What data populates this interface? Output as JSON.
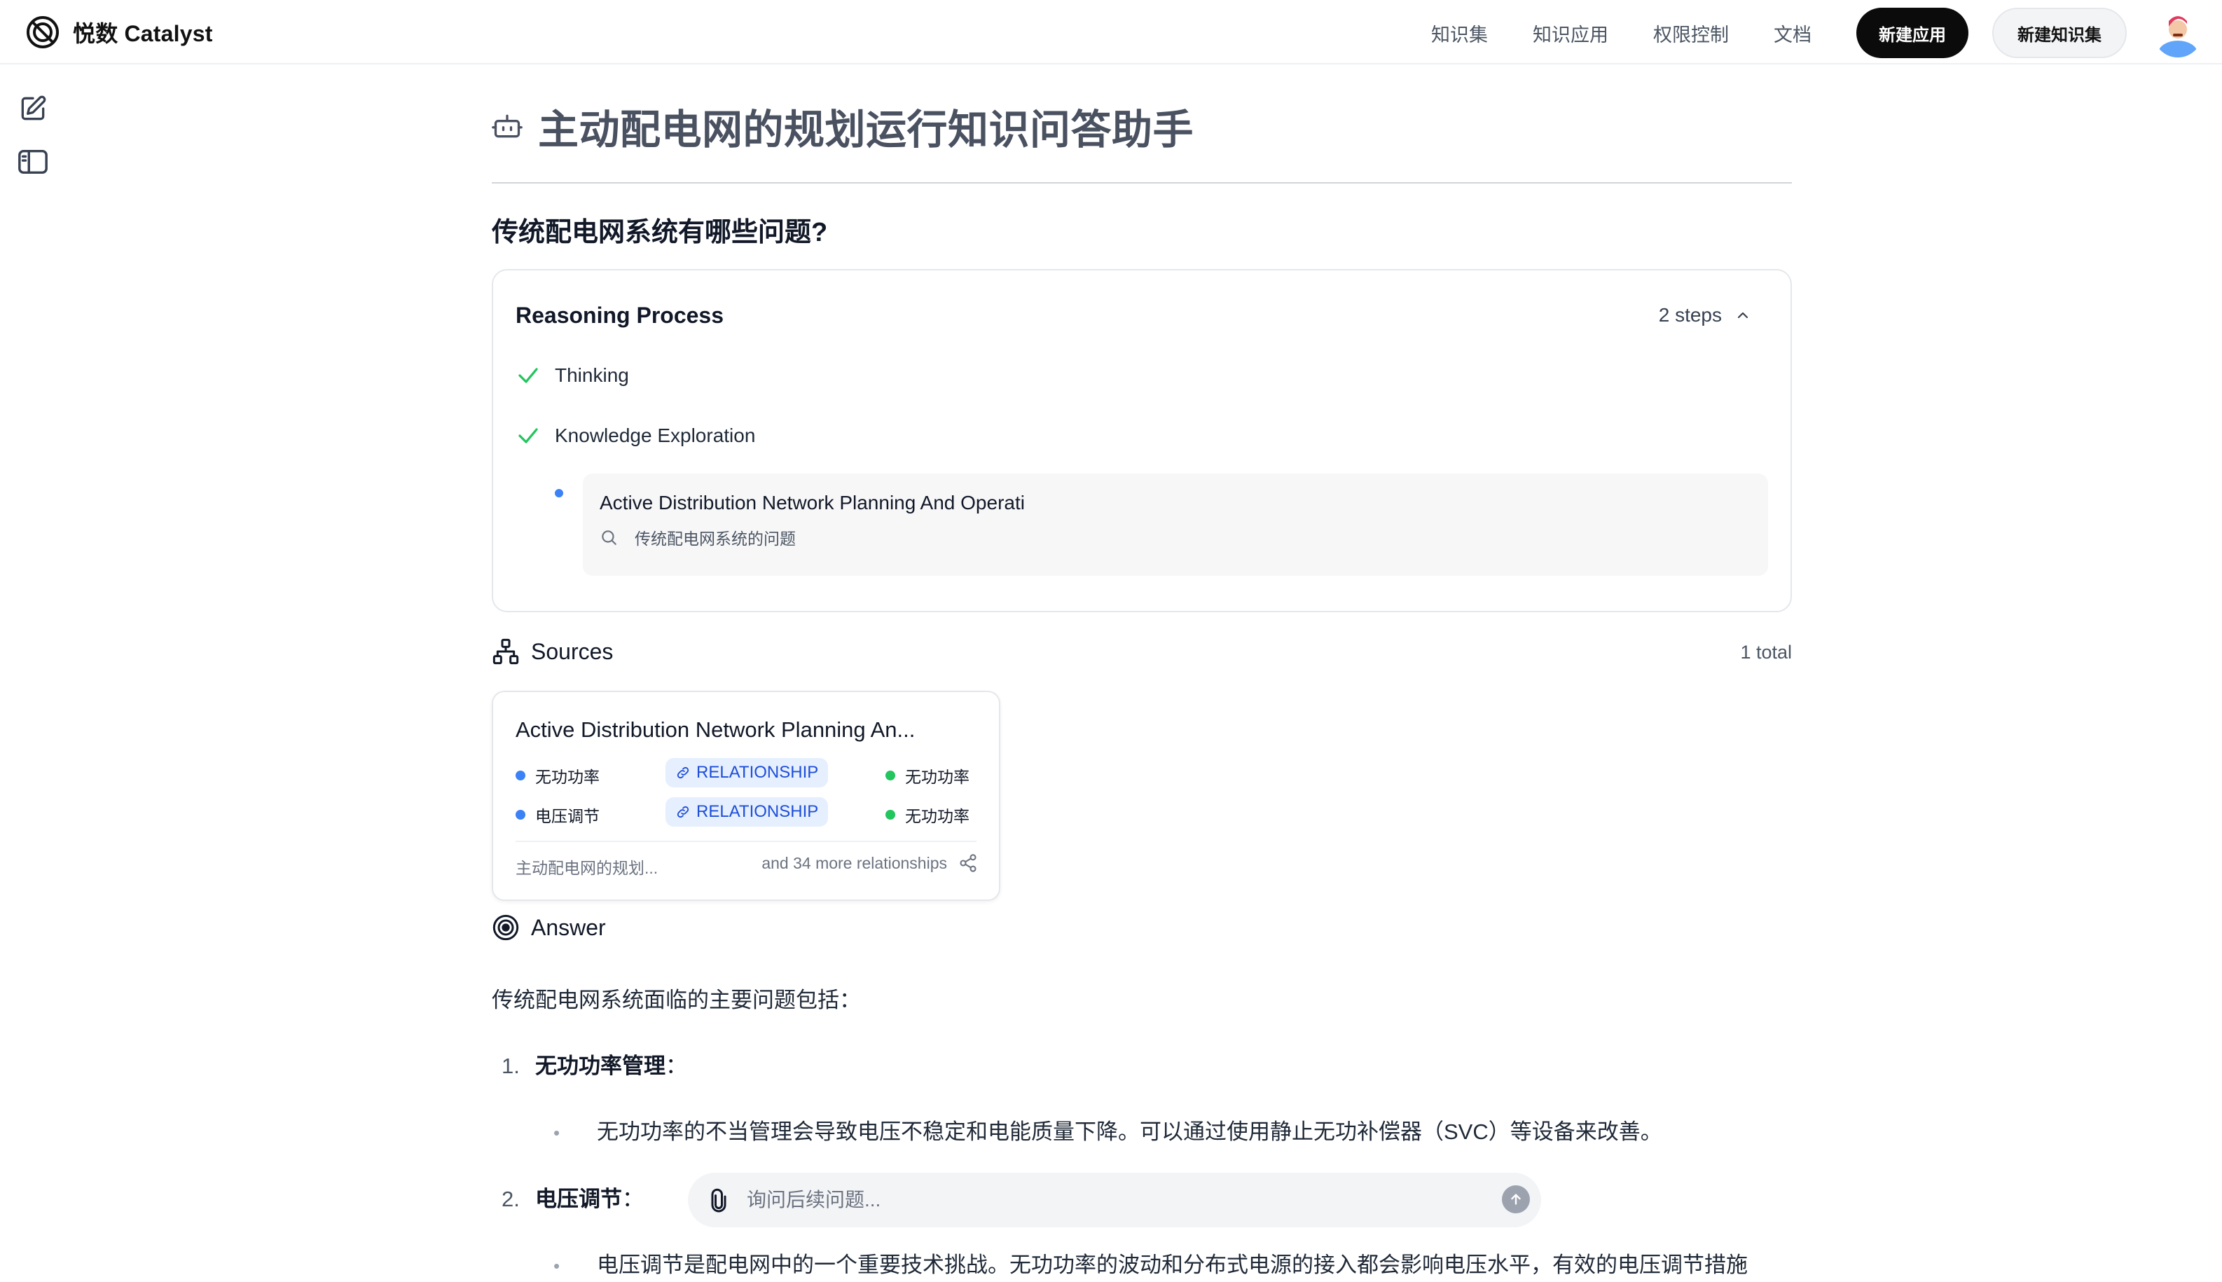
{
  "header": {
    "brand": "悦数 Catalyst",
    "nav": [
      "知识集",
      "知识应用",
      "权限控制",
      "文档"
    ],
    "new_app_button": "新建应用",
    "new_kb_button": "新建知识集"
  },
  "page": {
    "title": "主动配电网的规划运行知识问答助手",
    "question": "传统配电网系统有哪些问题?"
  },
  "reasoning": {
    "title": "Reasoning Process",
    "steps_count": "2 steps",
    "steps": [
      "Thinking",
      "Knowledge Exploration"
    ],
    "exploration": {
      "title": "Active Distribution Network Planning And Operati",
      "query": "传统配电网系统的问题"
    }
  },
  "sources": {
    "label": "Sources",
    "total": "1 total",
    "card": {
      "title": "Active Distribution Network Planning An...",
      "relations": [
        {
          "from": "无功功率",
          "type": "RELATIONSHIP",
          "to": "无功功率"
        },
        {
          "from": "电压调节",
          "type": "RELATIONSHIP",
          "to": "无功功率"
        }
      ],
      "footer_left": "主动配电网的规划...",
      "footer_right": "and 34 more relationships"
    }
  },
  "answer": {
    "label": "Answer",
    "intro": "传统配电网系统面临的主要问题包括：",
    "items": [
      {
        "num": "1.",
        "heading": "无功功率管理",
        "suffix": "：",
        "bullet": "无功功率的不当管理会导致电压不稳定和电能质量下降。可以通过使用静止无功补偿器（SVC）等设备来改善。"
      },
      {
        "num": "2.",
        "heading": "电压调节",
        "suffix": "：",
        "bullet": "电压调节是配电网中的一个重要技术挑战。无功功率的波动和分布式电源的接入都会影响电压水平，有效的电压调节措施"
      }
    ]
  },
  "followup": {
    "placeholder": "询问后续问题..."
  },
  "colors": {
    "accent_dark": "#0b0b0b",
    "check_green": "#22c55e",
    "entity_blue": "#3b82f6",
    "entity_green": "#22c55e",
    "badge_bg": "#e6effe"
  }
}
